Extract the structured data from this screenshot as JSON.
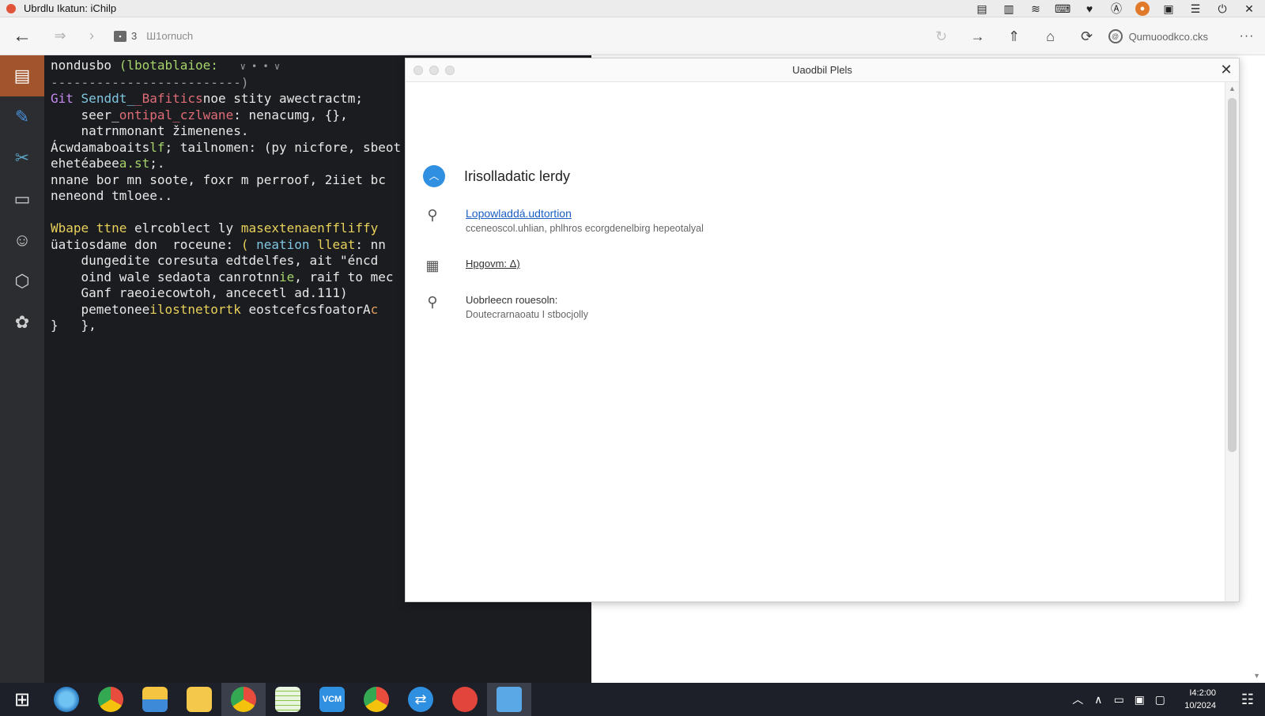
{
  "menubar": {
    "app_title": "Ubrdlu Ikatun: iChilp",
    "tray_icons": [
      "battery-icon",
      "display-icon",
      "wifi-icon",
      "keyboard-icon",
      "heart-icon",
      "a-icon",
      "orange-app-icon",
      "screen-icon",
      "list-icon",
      "power-icon",
      "close-icon"
    ]
  },
  "toolbar": {
    "tab_count": "3",
    "tab_label": "Ш1ornuch",
    "profile_text": "Qumuoodkco.cks",
    "more_label": "···"
  },
  "sidebar": {
    "items": [
      "editor-icon",
      "paint-brush-icon",
      "tools-icon",
      "window-icon",
      "emoji-icon",
      "hexagon-icon",
      "film-reel-icon"
    ]
  },
  "editor": {
    "lines": [
      [
        "nondusbo ",
        "(lbotablaioe:",
        " "
      ],
      [
        "-------------------------)"
      ],
      [
        "Git",
        "Senddt_",
        "_Bafitics",
        "noe stity awectractm;"
      ],
      [
        "    seer_",
        "ontipal_czlwane",
        ": nenacumg, {},"
      ],
      [
        "    natrnmonant žimenenes."
      ],
      [
        "Ácwdamaboaits",
        "lf",
        "; tailnomen: (py nicfore, sbeot"
      ],
      [
        "ehetéabee",
        "a.st",
        ";."
      ],
      [
        "nnane bor mn soote, foxr m perroof, 2iiet bc"
      ],
      [
        "neneond tmloee.."
      ],
      [
        ""
      ],
      [
        "Wbape ttne",
        " elrcoblect ly ",
        "masextenaenffl",
        "iffy"
      ],
      [
        "üatiosdame don  roceune: ",
        "(",
        " neation ",
        "lleat",
        ": nn"
      ],
      [
        "    dungedite coresuta edtdelfes, ait \"éncd"
      ],
      [
        "    oind wale sedaota canrotnn",
        "ie",
        ", raif to mec"
      ],
      [
        "    Ganf raeoiecowtoh, ancecetl ad.111)"
      ],
      [
        "    pemetonee",
        "ilostnetortk ",
        "eostcefcsfoatorA",
        "c"
      ],
      [
        "}   },"
      ]
    ],
    "fold_marker": "∨ • • ∨"
  },
  "dialog": {
    "title": "Uaodbil Plels",
    "heading": "Irisolladatic lerdy",
    "rows": [
      {
        "icon": "search-icon",
        "title": "Lopowladdá.udtortion",
        "sub": "cceneoscol.uhlian, phlhros ecorgdenelbirg hepeotalyal"
      },
      {
        "icon": "calendar-edit-icon",
        "title": "Hpgovm: Δ)",
        "sub": ""
      },
      {
        "icon": "search-icon",
        "title": "Uobrleecn rouesoln:",
        "sub": "Doutecrarnaoatu I stbocjolly"
      }
    ]
  },
  "taskbar": {
    "apps": [
      "safari-icon",
      "chrome-icon",
      "files-icon",
      "folder-icon",
      "chrome-icon",
      "notes-icon",
      "vcm-icon",
      "chrome-icon",
      "sync-icon",
      "red-app-icon",
      "bin-icon"
    ],
    "vcm_label": "VCM",
    "time": "I4:2:00",
    "date": "10/2024"
  }
}
